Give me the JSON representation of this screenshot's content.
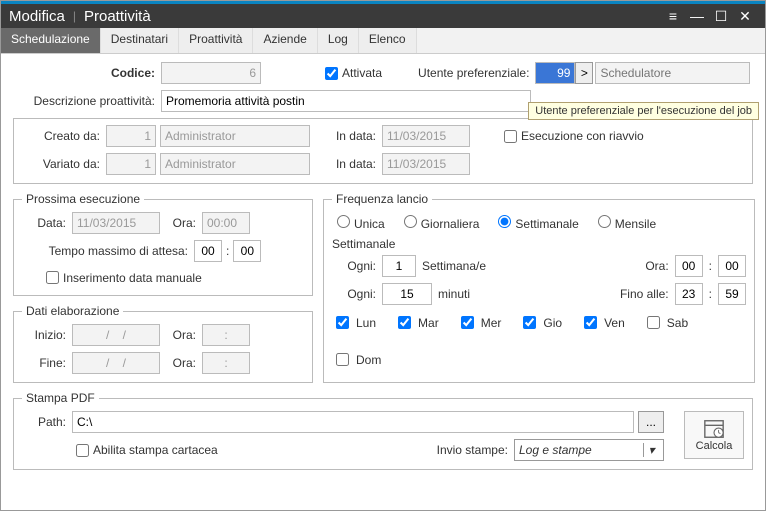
{
  "titlebar": {
    "left": "Modifica",
    "right": "Proattività"
  },
  "tabs": [
    "Schedulazione",
    "Destinatari",
    "Proattività",
    "Aziende",
    "Log",
    "Elenco"
  ],
  "labels": {
    "codice": "Codice:",
    "attivata": "Attivata",
    "utente_pref": "Utente preferenziale:",
    "schedulatore_ph": "Schedulatore",
    "descrizione": "Descrizione proattività:",
    "creato_da": "Creato da:",
    "variato_da": "Variato da:",
    "in_data": "In data:",
    "esecuzione_riavvio": "Esecuzione con riavvio",
    "prossima_esec": "Prossima esecuzione",
    "data": "Data:",
    "ora": "Ora:",
    "tempo_massimo": "Tempo massimo di attesa:",
    "inserimento_manuale": "Inserimento data manuale",
    "dati_elab": "Dati elaborazione",
    "inizio": "Inizio:",
    "fine": "Fine:",
    "frequenza": "Frequenza lancio",
    "unica": "Unica",
    "giornaliera": "Giornaliera",
    "settimanale": "Settimanale",
    "mensile": "Mensile",
    "settimanale_group": "Settimanale",
    "ogni": "Ogni:",
    "settimana_e": "Settimana/e",
    "minuti": "minuti",
    "fino_alle": "Fino alle:",
    "days": {
      "lun": "Lun",
      "mar": "Mar",
      "mer": "Mer",
      "gio": "Gio",
      "ven": "Ven",
      "sab": "Sab",
      "dom": "Dom"
    },
    "stampa_pdf": "Stampa PDF",
    "path": "Path:",
    "abilita_stampa": "Abilita stampa cartacea",
    "invio_stampe": "Invio stampe:",
    "calcola": "Calcola",
    "browse": "...",
    "lookup": ">",
    "colon": ":"
  },
  "values": {
    "codice": "6",
    "utente_pref": "99",
    "descrizione": "Promemoria attività postin",
    "creato_da_id": "1",
    "creato_da_name": "Administrator",
    "creato_in_data": "11/03/2015",
    "variato_da_id": "1",
    "variato_da_name": "Administrator",
    "variato_in_data": "11/03/2015",
    "prossima_data": "11/03/2015",
    "prossima_ora": "00:00",
    "tempo_h": "00",
    "tempo_m": "00",
    "inizio_data": "/    /",
    "inizio_ora": ":",
    "fine_data": "/    /",
    "fine_ora": ":",
    "ogni_settimane": "1",
    "ogni_minuti": "15",
    "ora_h": "00",
    "ora_m": "00",
    "fino_h": "23",
    "fino_m": "59",
    "path": "C:\\",
    "invio_stampe_sel": "Log e stampe"
  },
  "tooltip": "Utente preferenziale per l'esecuzione del job"
}
